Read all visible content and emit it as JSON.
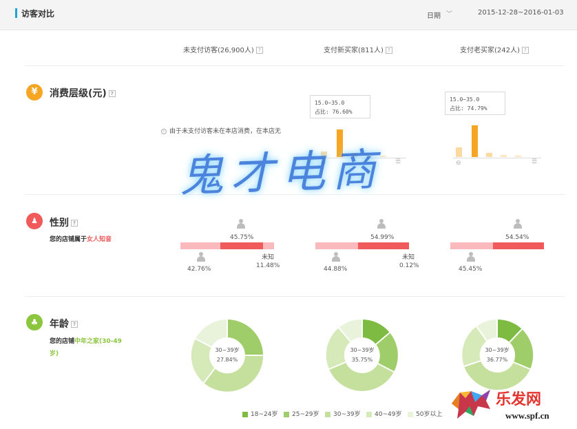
{
  "header": {
    "title": "访客对比",
    "period": "日期",
    "date_range": "2015-12-28~2016-01-03"
  },
  "columns": [
    "未支付访客(26,900人)",
    "支付新买家(811人)",
    "支付老买家(242人)"
  ],
  "help_glyph": "?",
  "consumption": {
    "title": "消费层级(元)",
    "icon": "yen-icon",
    "icon_glyph": "¥",
    "note": "由于未支付访客未在本店消费，在本店无",
    "tooltips": [
      {
        "range": "15.0~35.0",
        "share": "占比: 76.60%"
      },
      {
        "range": "15.0~35.0",
        "share": "占比: 74.79%"
      }
    ]
  },
  "gender": {
    "title": "性别",
    "icon": "users-icon",
    "subtitle_prefix": "您的店铺属于",
    "subtitle_highlight": "女人知音",
    "unknown_label": "未知",
    "groups": [
      {
        "top_pct": "45.75%",
        "bottom_pct": "42.76%",
        "unknown_pct": "11.48%"
      },
      {
        "top_pct": "54.99%",
        "bottom_pct": "44.88%",
        "unknown_pct": "0.12%"
      },
      {
        "top_pct": "54.54%",
        "bottom_pct": "45.45%",
        "unknown_pct": ""
      }
    ]
  },
  "age": {
    "title": "年龄",
    "icon": "tree-icon",
    "subtitle_prefix": "您的店铺",
    "subtitle_highlight": "中年之家(30-49",
    "subtitle_suffix": "岁)",
    "donuts": [
      {
        "center_label": "30~39岁",
        "center_value": "27.84%"
      },
      {
        "center_label": "30~39岁",
        "center_value": "35.75%"
      },
      {
        "center_label": "30~39岁",
        "center_value": "36.77%"
      }
    ],
    "legend": [
      {
        "label": "18~24岁",
        "color": "#7dbb42"
      },
      {
        "label": "25~29岁",
        "color": "#9fcd6a"
      },
      {
        "label": "30~39岁",
        "color": "#c5e09d"
      },
      {
        "label": "40~49岁",
        "color": "#d6e9b9"
      },
      {
        "label": "50岁以上",
        "color": "#e9f3db"
      }
    ]
  },
  "watermark": "鬼才电商",
  "logo": {
    "brand": "乐发网",
    "url": "www.spf.cn"
  }
}
